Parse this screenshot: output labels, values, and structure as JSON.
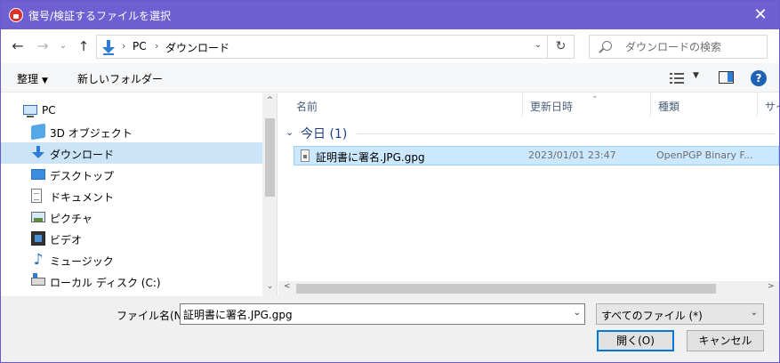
{
  "window": {
    "title": "復号/検証するファイルを選択",
    "close_glyph": "✕"
  },
  "nav": {
    "back_glyph": "←",
    "forward_glyph": "→",
    "recent_glyph": "⌄",
    "up_glyph": "↑",
    "breadcrumb": [
      "PC",
      "ダウンロード"
    ],
    "separator": "›",
    "dropdown_glyph": "⌄",
    "refresh_glyph": "↻",
    "search_placeholder": "ダウンロードの検索"
  },
  "toolbar": {
    "organize_label": "整理",
    "organize_caret": "▼",
    "new_folder_label": "新しいフォルダー",
    "view_caret": "▼",
    "help_glyph": "?"
  },
  "sidebar": {
    "items": [
      {
        "label": "PC",
        "icon": "pc-icon"
      },
      {
        "label": "3D オブジェクト",
        "icon": "3d-objects-icon"
      },
      {
        "label": "ダウンロード",
        "icon": "download-icon",
        "selected": true
      },
      {
        "label": "デスクトップ",
        "icon": "desktop-icon"
      },
      {
        "label": "ドキュメント",
        "icon": "documents-icon"
      },
      {
        "label": "ピクチャ",
        "icon": "pictures-icon"
      },
      {
        "label": "ビデオ",
        "icon": "videos-icon"
      },
      {
        "label": "ミュージック",
        "icon": "music-icon"
      },
      {
        "label": "ローカル ディスク (C:)",
        "icon": "local-disk-icon"
      }
    ],
    "scroll_up": "^",
    "scroll_down": "⌄"
  },
  "file_list": {
    "columns": [
      "名前",
      "更新日時",
      "種類",
      "サイ"
    ],
    "sort_caret": "⌄",
    "group": {
      "caret": "⌄",
      "label": "今日 (1)"
    },
    "files": [
      {
        "name": "証明書に署名.JPG.gpg",
        "modified": "2023/01/01 23:47",
        "type": "OpenPGP Binary F..."
      }
    ],
    "hscroll_left": "<",
    "hscroll_right": ">"
  },
  "bottom": {
    "filename_label": "ファイル名(N):",
    "filename_value": "証明書に署名.JPG.gpg",
    "combo_caret": "⌄",
    "filetype_value": "すべてのファイル (*)",
    "open_label": "開く(O)",
    "cancel_label": "キャンセル"
  },
  "colors": {
    "titlebar": "#6e5fd2",
    "selection": "#cce8ff",
    "accent": "#0078d7"
  }
}
